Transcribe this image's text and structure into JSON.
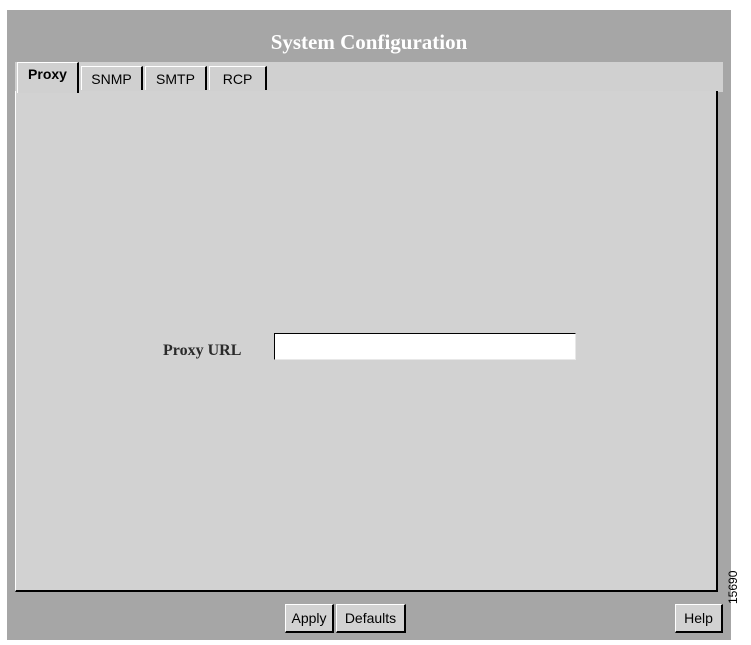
{
  "window": {
    "title": "System Configuration"
  },
  "tabs": [
    {
      "label": "Proxy",
      "active": true
    },
    {
      "label": "SNMP",
      "active": false
    },
    {
      "label": "SMTP",
      "active": false
    },
    {
      "label": "RCP",
      "active": false
    }
  ],
  "proxy": {
    "url_label": "Proxy URL",
    "url_value": ""
  },
  "footer": {
    "apply_label": "Apply",
    "defaults_label": "Defaults",
    "help_label": "Help"
  },
  "figure_number": "15690",
  "colors": {
    "frame": "#a6a6a6",
    "panel": "#d2d2d2",
    "title_text": "#ffffff"
  }
}
